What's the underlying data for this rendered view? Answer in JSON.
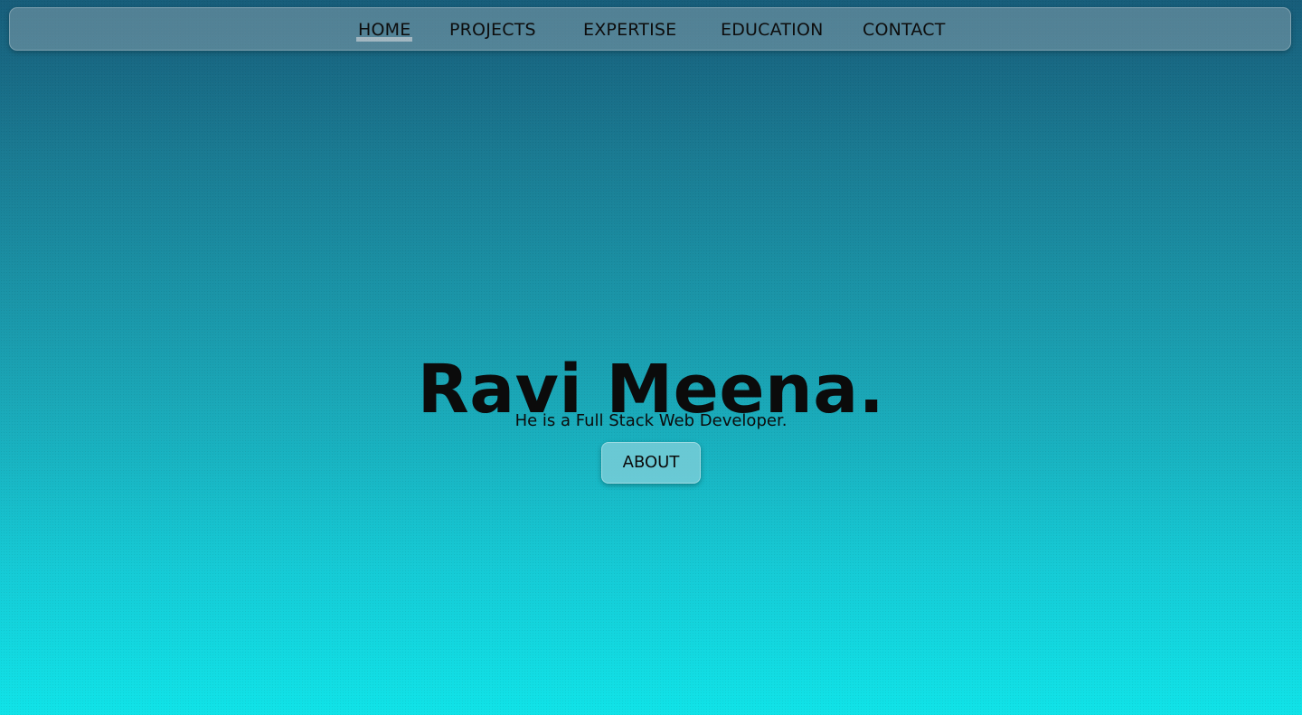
{
  "nav": {
    "items": [
      {
        "label": "HOME",
        "active": true
      },
      {
        "label": "PROJECTS",
        "active": false
      },
      {
        "label": "EXPERTISE",
        "active": false
      },
      {
        "label": "EDUCATION",
        "active": false
      },
      {
        "label": "CONTACT",
        "active": false
      }
    ]
  },
  "hero": {
    "title": "Ravi Meena.",
    "subtitle": "He is a Full Stack Web Developer.",
    "button_label": "ABOUT"
  },
  "colors": {
    "gradient_top": "#175d7a",
    "gradient_bottom": "#10e3e8",
    "nav_background": "#7896a5",
    "button_background": "#78cdd7",
    "text": "#0b0b0b"
  }
}
